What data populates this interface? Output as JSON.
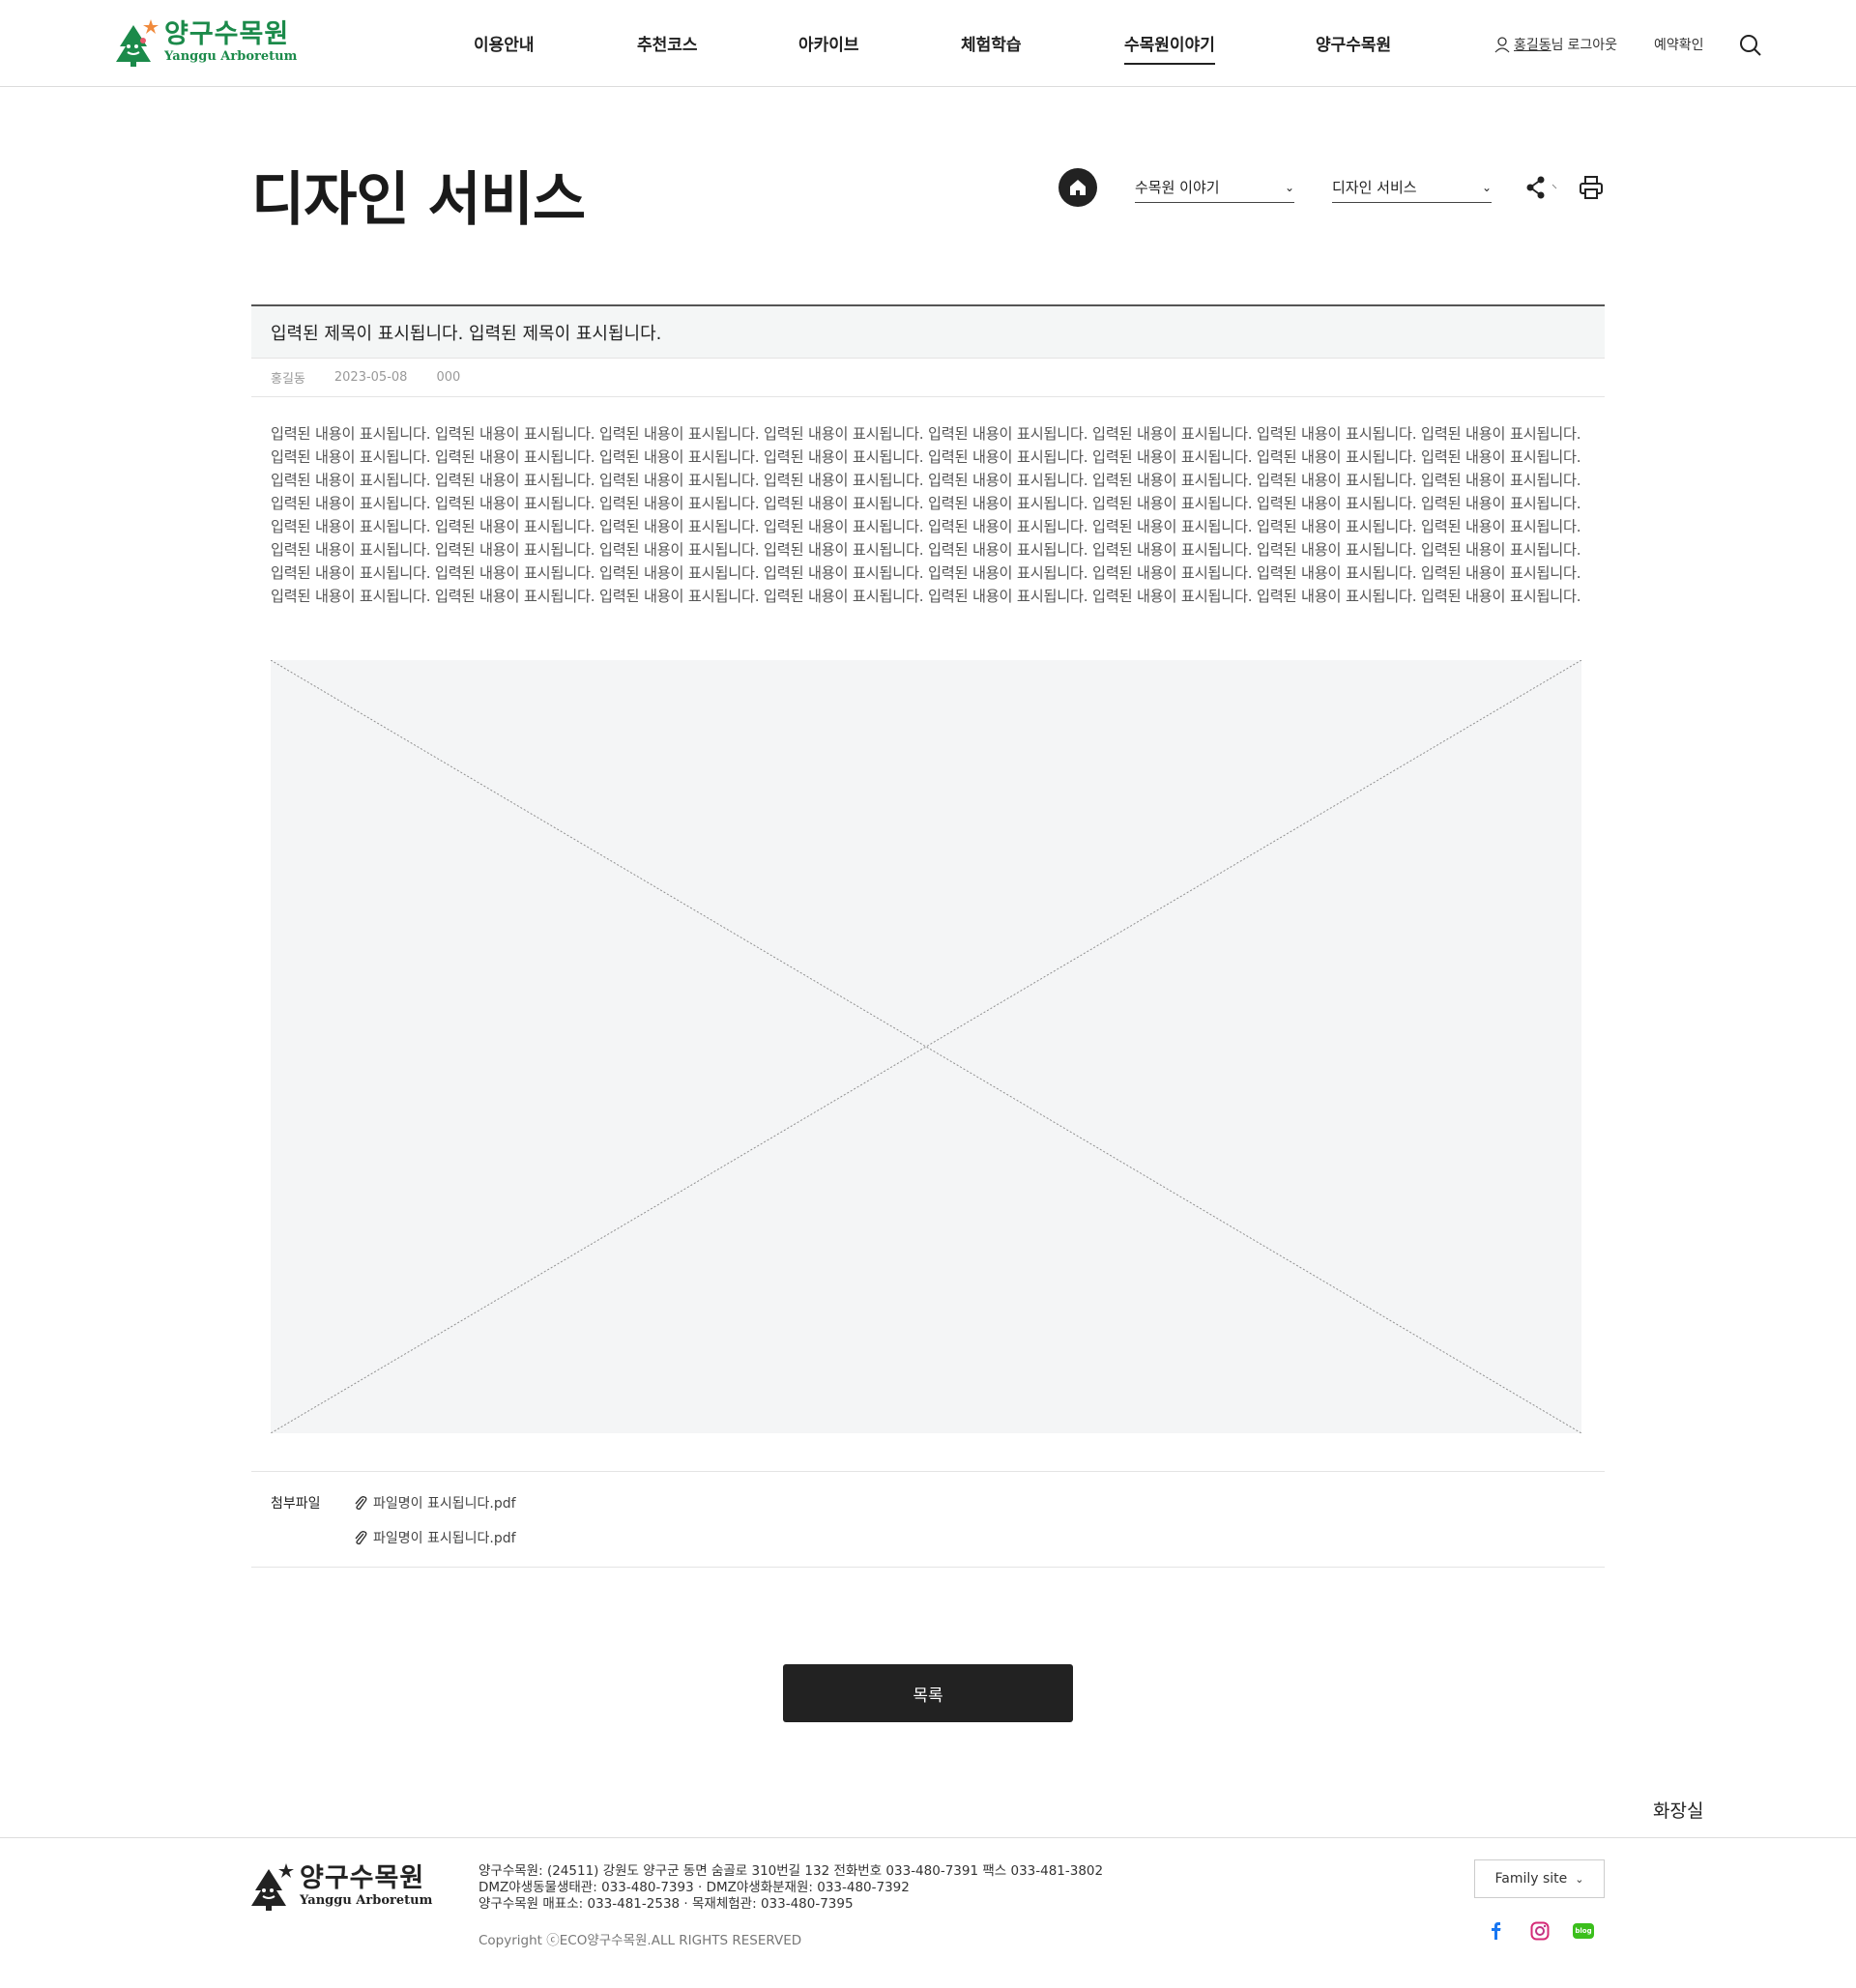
{
  "header": {
    "logo_ko": "양구수목원",
    "logo_en": "Yanggu Arboretum",
    "nav": [
      "이용안내",
      "추천코스",
      "아카이브",
      "체험학습",
      "수목원이야기",
      "양구수목원"
    ],
    "active_nav": "수목원이야기",
    "user_name": "홍길동",
    "user_suffix": "님",
    "logout": "로그아웃",
    "reservation": "예약확인"
  },
  "page": {
    "title": "디자인 서비스",
    "select1": "수목원 이야기",
    "select2": "디자인 서비스"
  },
  "post": {
    "title": "입력된 제목이 표시됩니다. 입력된 제목이 표시됩니다.",
    "author": "홍길동",
    "date": "2023-05-08",
    "views": "000",
    "body": "입력된 내용이 표시됩니다. 입력된 내용이 표시됩니다. 입력된 내용이 표시됩니다. 입력된 내용이 표시됩니다. 입력된 내용이 표시됩니다. 입력된 내용이 표시됩니다. 입력된 내용이 표시됩니다. 입력된 내용이 표시됩니다. 입력된 내용이 표시됩니다. 입력된 내용이 표시됩니다. 입력된 내용이 표시됩니다. 입력된 내용이 표시됩니다. 입력된 내용이 표시됩니다. 입력된 내용이 표시됩니다. 입력된 내용이 표시됩니다. 입력된 내용이 표시됩니다. 입력된 내용이 표시됩니다. 입력된 내용이 표시됩니다. 입력된 내용이 표시됩니다.  입력된 내용이 표시됩니다. 입력된 내용이 표시됩니다.  입력된 내용이 표시됩니다. 입력된 내용이 표시됩니다. 입력된 내용이 표시됩니다. 입력된 내용이 표시됩니다. 입력된 내용이 표시됩니다. 입력된 내용이 표시됩니다. 입력된 내용이 표시됩니다. 입력된 내용이 표시됩니다. 입력된 내용이 표시됩니다. 입력된 내용이 표시됩니다. 입력된 내용이 표시됩니다. 입력된 내용이 표시됩니다. 입력된 내용이 표시됩니다. 입력된 내용이 표시됩니다. 입력된 내용이 표시됩니다. 입력된 내용이 표시됩니다. 입력된 내용이 표시됩니다. 입력된 내용이 표시됩니다. 입력된 내용이 표시됩니다. 입력된 내용이 표시됩니다.  입력된 내용이 표시됩니다. 입력된 내용이 표시됩니다.  입력된 내용이 표시됩니다. 입력된 내용이 표시됩니다. 입력된 내용이 표시됩니다. 입력된 내용이 표시됩니다. 입력된 내용이 표시됩니다. 입력된 내용이 표시됩니다. 입력된 내용이 표시됩니다. 입력된 내용이 표시됩니다. 입력된 내용이 표시됩니다. 입력된 내용이 표시됩니다. 입력된 내용이 표시됩니다. 입력된 내용이 표시됩니다. 입력된 내용이 표시됩니다. 입력된 내용이 표시됩니다. 입력된 내용이 표시됩니다. 입력된 내용이 표시됩니다. 입력된 내용이 표시됩니다. 입력된 내용이 표시됩니다.  입력된 내용이 표시됩니다. 입력된 내용이 표시됩니다.  입력된 내용이 표시됩니다."
  },
  "attachments": {
    "label": "첨부파일",
    "files": [
      "파일명이 표시됩니다.pdf",
      "파일명이 표시됩니다.pdf"
    ]
  },
  "list_button": "목록",
  "floating_text": "화장실",
  "footer": {
    "logo_ko": "양구수목원",
    "logo_en": "Yanggu Arboretum",
    "info": [
      "양구수목원: (24511) 강원도 양구군 동면 숨골로 310번길 132 전화번호 033-480-7391 팩스 033-481-3802",
      "DMZ야생동물생태관: 033-480-7393 · DMZ야생화분재원: 033-480-7392",
      "양구수목원 매표소: 033-481-2538 · 목재체험관: 033-480-7395"
    ],
    "copyright": "Copyright ⓒECO양구수목원.ALL RIGHTS RESERVED",
    "family_site": "Family site",
    "sns": [
      "facebook-icon",
      "instagram-icon",
      "blog-icon"
    ],
    "blog_text": "blog"
  },
  "colors": {
    "brand_green": "#1b8a4a",
    "dark": "#222222",
    "title_bg": "#f4f6f6"
  }
}
